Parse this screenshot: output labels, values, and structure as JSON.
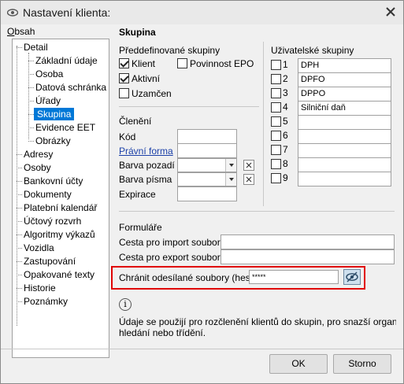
{
  "window": {
    "title": "Nastavení klienta:"
  },
  "tree": {
    "label": "Obsah",
    "items": [
      {
        "label": "Detail"
      },
      {
        "label": "Základní údaje"
      },
      {
        "label": "Osoba"
      },
      {
        "label": "Datová schránka"
      },
      {
        "label": "Úřady"
      },
      {
        "label": "Skupina"
      },
      {
        "label": "Evidence EET"
      },
      {
        "label": "Obrázky"
      },
      {
        "label": "Adresy"
      },
      {
        "label": "Osoby"
      },
      {
        "label": "Bankovní účty"
      },
      {
        "label": "Dokumenty"
      },
      {
        "label": "Platební kalendář"
      },
      {
        "label": "Účtový rozvrh"
      },
      {
        "label": "Algoritmy výkazů"
      },
      {
        "label": "Vozidla"
      },
      {
        "label": "Zastupování"
      },
      {
        "label": "Opakované texty"
      },
      {
        "label": "Historie"
      },
      {
        "label": "Poznámky"
      }
    ]
  },
  "section_title": "Skupina",
  "predefined": {
    "title": "Předdefinované skupiny",
    "items": [
      {
        "label": "Klient",
        "checked": true
      },
      {
        "label": "Povinnost EPO",
        "checked": false
      },
      {
        "label": "Aktivní",
        "checked": true
      },
      {
        "label": "Uzamčen",
        "checked": false
      }
    ]
  },
  "user_groups": {
    "title": "Uživatelské skupiny",
    "items": [
      {
        "num": "1",
        "value": "DPH"
      },
      {
        "num": "2",
        "value": "DPFO"
      },
      {
        "num": "3",
        "value": "DPPO"
      },
      {
        "num": "4",
        "value": "Silniční daň"
      },
      {
        "num": "5",
        "value": ""
      },
      {
        "num": "6",
        "value": ""
      },
      {
        "num": "7",
        "value": ""
      },
      {
        "num": "8",
        "value": ""
      },
      {
        "num": "9",
        "value": ""
      }
    ]
  },
  "cleneni": {
    "title": "Členění",
    "kod_label": "Kód",
    "kod_value": "",
    "pravni_forma_label": "Právní forma",
    "pravni_forma_value": "",
    "barva_pozadi_label": "Barva pozadí",
    "barva_pisma_label": "Barva písma",
    "expirace_label": "Expirace",
    "expirace_value": ""
  },
  "formulare": {
    "title": "Formuláře",
    "import_label": "Cesta pro import souborů",
    "import_value": "",
    "export_label": "Cesta pro export souborů",
    "export_value": "",
    "password_label": "Chránit odesílané soubory (heslo)",
    "password_value": "*****"
  },
  "info": {
    "icon": "i",
    "text_line1": "Údaje se použijí pro rozčlenění klientů do skupin, pro snazší organizaci vě",
    "text_line2": "hledání nebo třídění."
  },
  "buttons": {
    "ok": "OK",
    "storno": "Storno"
  }
}
